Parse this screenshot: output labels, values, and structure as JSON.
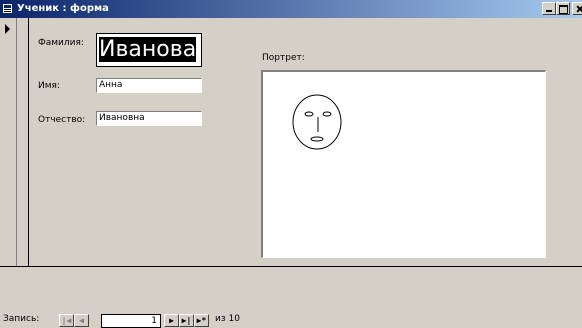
{
  "window": {
    "title": "Ученик : форма",
    "buttons": {
      "minimize": "minimize",
      "maximize": "maximize",
      "close": "close"
    }
  },
  "form": {
    "surname": {
      "label": "Фамилия:",
      "value": "Иванова"
    },
    "name": {
      "label": "Имя:",
      "value": "Анна"
    },
    "patronymic": {
      "label": "Отчество:",
      "value": "Ивановна"
    },
    "portrait": {
      "label": "Портрет:"
    }
  },
  "navigation": {
    "record_label": "Запись:",
    "current_record": "1",
    "total_text": "из 10",
    "buttons": {
      "first": "first-record-icon",
      "prev": "previous-record-icon",
      "next": "next-record-icon",
      "last": "last-record-icon",
      "new": "new-record-icon"
    }
  }
}
